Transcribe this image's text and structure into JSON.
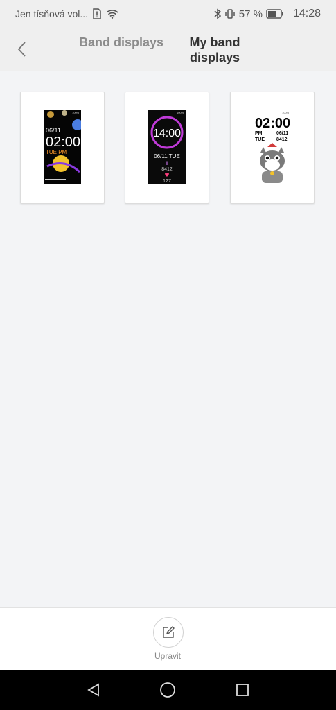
{
  "status_bar": {
    "carrier": "Jen tísňová vol...",
    "battery_percent": "57 %",
    "time": "14:28",
    "icons": [
      "sim-alert-icon",
      "wifi-icon",
      "bluetooth-icon",
      "vibrate-icon",
      "battery-icon"
    ]
  },
  "header": {
    "tabs": [
      {
        "label": "Band displays",
        "active": false
      },
      {
        "label": "My band\ndisplays",
        "active": true
      }
    ]
  },
  "displays": [
    {
      "name": "planets",
      "date": "06/11",
      "time": "02:00",
      "day": "TUE PM",
      "battery": "100%"
    },
    {
      "name": "ring",
      "time": "14:00",
      "date": "06/11 TUE",
      "steps": "8412",
      "heart": "127",
      "battery": "100%"
    },
    {
      "name": "cat",
      "time": "02:00",
      "period": "PM",
      "date": "06/11",
      "day": "TUE",
      "steps": "8412",
      "battery": "100%"
    }
  ],
  "bottom": {
    "edit_label": "Upravit"
  },
  "colors": {
    "accent_purple": "#c03ad8",
    "accent_pink": "#ff3f7f",
    "text_orange": "#ff9a2a"
  }
}
